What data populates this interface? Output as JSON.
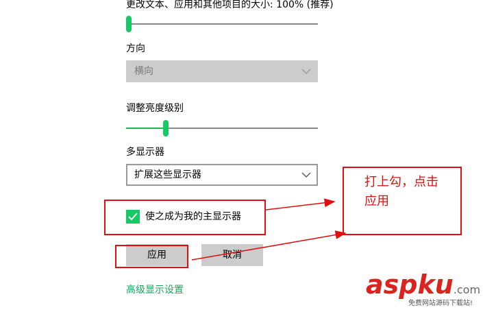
{
  "scale": {
    "label": "更改文本、应用和其他项目的大小: 100% (推荐)",
    "slider_level": 0.0
  },
  "orientation": {
    "label": "方向",
    "value": "横向",
    "disabled": true
  },
  "brightness": {
    "label": "调整亮度级别",
    "slider_level": 0.2
  },
  "multiple_displays": {
    "label": "多显示器",
    "value": "扩展这些显示器"
  },
  "main_display_checkbox": {
    "label": "使之成为我的主显示器",
    "checked": true
  },
  "buttons": {
    "apply": "应用",
    "cancel": "取消"
  },
  "advanced_link": "高级显示设置",
  "annotation": {
    "line1": "打上勾，点击",
    "line2": "应用"
  },
  "watermark": {
    "brand": "aspku",
    "suffix": ".com",
    "tagline": "免费网站源码下载站!"
  },
  "colors": {
    "accent": "#17c964",
    "annotation_red": "#e01010",
    "link": "#17a65c"
  }
}
